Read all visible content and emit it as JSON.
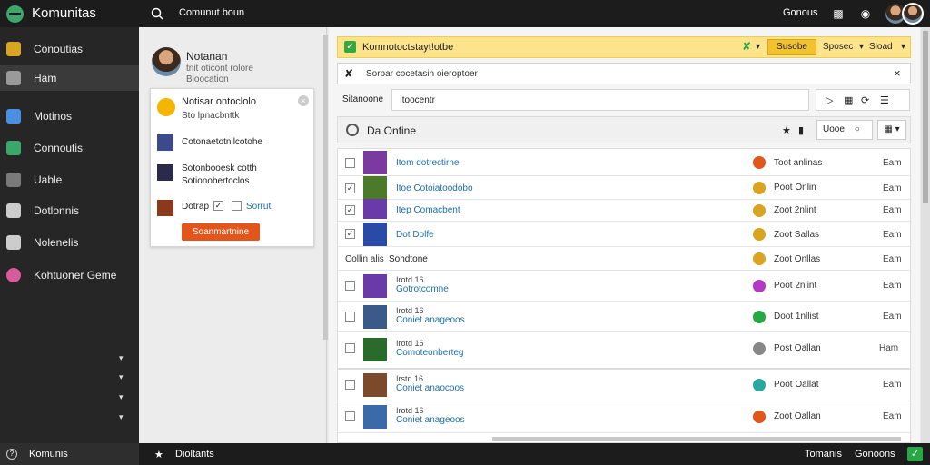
{
  "app": {
    "brand": "Komunitas",
    "search_label": "Comunut boun",
    "right_label": "Gonous"
  },
  "sidebar": {
    "items": [
      {
        "label": "Conoutias",
        "icon": "folder-icon",
        "color": "#d9a521"
      },
      {
        "label": "Ham",
        "icon": "home-icon",
        "color": "#9a9a9a"
      },
      {
        "label": "Motinos",
        "icon": "puzzle-icon",
        "color": "#4a8fe0"
      },
      {
        "label": "Connoutis",
        "icon": "grid-icon",
        "color": "#3aa86b"
      },
      {
        "label": "Uable",
        "icon": "tag-icon",
        "color": "#9a9a9a"
      },
      {
        "label": "Dotlonnis",
        "icon": "list-icon",
        "color": "#cccccc"
      },
      {
        "label": "Nolenelis",
        "icon": "window-icon",
        "color": "#cccccc"
      },
      {
        "label": "Kohtuoner Geme",
        "icon": "game-icon",
        "color": "#d95c9a"
      }
    ]
  },
  "profile": {
    "name": "Notanan",
    "sub": "tnit oticont rolore",
    "sub2": "Bioocation"
  },
  "card": {
    "title": "Notisar ontoclolo",
    "subtitle": "Sto lpnacbnttk",
    "items": [
      "Cotonaetotnilcotohe",
      "Sotonbooesk cotth",
      "Sotionobertoclos"
    ],
    "option_a": "Dotrap",
    "option_b": "Sorrut",
    "button": "Soanmartnine"
  },
  "notice": {
    "text": "Komnotoctstayt!otbe",
    "button": "Susobe",
    "link1": "Sposec",
    "link2": "Sload"
  },
  "search": {
    "placeholder": "Sorpar cocetasin oieroptoer"
  },
  "filter": {
    "label": "Sitanoone",
    "value": "Itoocentr"
  },
  "list": {
    "header": "Da Onfine",
    "view_button": "Uooe",
    "rows": [
      {
        "title": "Itom dotrectirne",
        "status": "Toot anlinas",
        "num": "Eam",
        "checked": false,
        "status_color": "#e2561c",
        "thumb": "#7a3aa0"
      },
      {
        "title": "Itoe Cotoiatoodobo",
        "status": "Poot Onlin",
        "num": "Eam",
        "checked": true,
        "status_color": "#d9a521",
        "thumb": "#4a7a2a"
      },
      {
        "title": "Itep Comacbent",
        "status": "Zoot 2nlint",
        "num": "Eam",
        "checked": true,
        "status_color": "#d9a521",
        "thumb": "#6a3aa8"
      },
      {
        "title": "Dot Dolfe",
        "status": "Zoot Sallas",
        "num": "Eam",
        "checked": true,
        "status_color": "#d9a521",
        "thumb": "#2a4aa8"
      }
    ],
    "section_label": "Collin alis",
    "section_title": "Sohdtone",
    "section_status": "Zoot Onllas",
    "rows2": [
      {
        "meta": "Irotd 16",
        "title": "Gotrotcomne",
        "status": "Poot 2nlint",
        "num": "Eam",
        "status_color": "#b33ac2",
        "thumb": "#6a3aa8"
      },
      {
        "meta": "Irotd 16",
        "title": "Coniet anageoos",
        "status": "Doot 1nllist",
        "num": "Eam",
        "status_color": "#27a844",
        "thumb": "#3a5a8a"
      },
      {
        "meta": "Irotd 16",
        "title": "Comoteonberteg",
        "status": "Post Oallan",
        "num": "Ham",
        "status_color": "#888888",
        "thumb": "#2a6a2a"
      }
    ],
    "rows3": [
      {
        "meta": "Irstd 16",
        "title": "Coniet anaocoos",
        "status": "Poot Oallat",
        "num": "Eam",
        "status_color": "#27a8a0",
        "thumb": "#7a4a2a"
      },
      {
        "meta": "Irotd 16",
        "title": "Coniet anageoos",
        "status": "Zoot Oallan",
        "num": "Eam",
        "status_color": "#e2561c",
        "thumb": "#3a6aa8"
      }
    ]
  },
  "bottom": {
    "left_label": "Komunis",
    "mid_label": "Dioltants",
    "right1": "Tomanis",
    "right2": "Gonoons"
  }
}
